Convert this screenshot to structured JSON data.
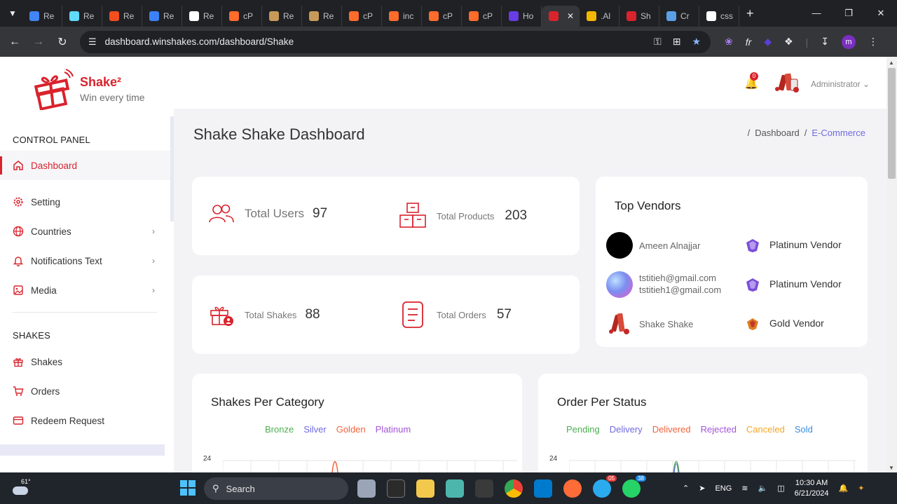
{
  "browser": {
    "tabs": [
      {
        "label": "Re",
        "color": "#4285f4"
      },
      {
        "label": "Re",
        "color": "#61dafb"
      },
      {
        "label": "Re",
        "color": "#f24e1e"
      },
      {
        "label": "Re",
        "color": "#3b82f6"
      },
      {
        "label": "Re",
        "color": "#ffffff"
      },
      {
        "label": "cP",
        "color": "#ff6c2c"
      },
      {
        "label": "Re",
        "color": "#c79a5a"
      },
      {
        "label": "Re",
        "color": "#c79a5a"
      },
      {
        "label": "cP",
        "color": "#ff6c2c"
      },
      {
        "label": "inc",
        "color": "#ff6c2c"
      },
      {
        "label": "cP",
        "color": "#ff6c2c"
      },
      {
        "label": "cP",
        "color": "#ff6c2c"
      },
      {
        "label": "Ho",
        "color": "#673de6"
      },
      {
        "label": "",
        "color": "#d9232d",
        "active": true
      },
      {
        "label": ".Al",
        "color": "#f5b800"
      },
      {
        "label": "Sh",
        "color": "#d9232d"
      },
      {
        "label": "Cr",
        "color": "#5aa0e6"
      },
      {
        "label": "css",
        "color": "#ffffff"
      }
    ],
    "url": "dashboard.winshakes.com/dashboard/Shake",
    "profile_initial": "m"
  },
  "sidebar": {
    "brand": "Shake²",
    "tagline": "Win every time",
    "control_panel_title": "CONTROL PANEL",
    "control_items": [
      {
        "label": "Dashboard",
        "icon": "home-icon",
        "has_chevron": false
      },
      {
        "label": "Setting",
        "icon": "gear-icon",
        "has_chevron": false
      },
      {
        "label": "Countries",
        "icon": "globe-icon",
        "has_chevron": true
      },
      {
        "label": "Notifications Text",
        "icon": "bell-icon",
        "has_chevron": true
      },
      {
        "label": "Media",
        "icon": "image-icon",
        "has_chevron": true
      }
    ],
    "shakes_title": "SHAKES",
    "shakes_items": [
      {
        "label": "Shakes",
        "icon": "gift-icon"
      },
      {
        "label": "Orders",
        "icon": "cart-icon"
      },
      {
        "label": "Redeem Request",
        "icon": "card-icon"
      }
    ]
  },
  "header": {
    "notification_count": "0",
    "user_name": "Administrator"
  },
  "page": {
    "title": "Shake Shake Dashboard",
    "breadcrumb": {
      "sep": "/",
      "parent": "Dashboard",
      "current": "E-Commerce"
    }
  },
  "stats": {
    "total_users": {
      "label": "Total Users",
      "value": "97"
    },
    "total_products": {
      "label": "Total Products",
      "value": "203"
    },
    "total_shakes": {
      "label": "Total Shakes",
      "value": "88"
    },
    "total_orders": {
      "label": "Total Orders",
      "value": "57"
    }
  },
  "top_vendors": {
    "title": "Top Vendors",
    "rows": [
      {
        "name_line1": "Ameen Alnajjar",
        "name_line2": "",
        "level": "Platinum Vendor",
        "avatar": "black"
      },
      {
        "name_line1": "tstitieh@gmail.com",
        "name_line2": "tstitieh1@gmail.com",
        "level": "Platinum Vendor",
        "avatar": "gradient"
      },
      {
        "name_line1": "Shake Shake",
        "name_line2": "",
        "level": "Gold Vendor",
        "avatar": "product"
      }
    ]
  },
  "charts": {
    "shakes_per_category": {
      "title": "Shakes Per Category",
      "legend": [
        {
          "label": "Bronze",
          "color": "#4caf50"
        },
        {
          "label": "Silver",
          "color": "#6f6ae0"
        },
        {
          "label": "Golden",
          "color": "#f0643c"
        },
        {
          "label": "Platinum",
          "color": "#a155d9"
        }
      ],
      "y_tick": "24"
    },
    "order_per_status": {
      "title": "Order Per Status",
      "legend": [
        {
          "label": "Pending",
          "color": "#4caf50"
        },
        {
          "label": "Delivery",
          "color": "#6f6ae0"
        },
        {
          "label": "Delivered",
          "color": "#f0643c"
        },
        {
          "label": "Rejected",
          "color": "#a155d9"
        },
        {
          "label": "Canceled",
          "color": "#f5a623"
        },
        {
          "label": "Sold",
          "color": "#3d8fe0"
        }
      ],
      "y_tick": "24"
    }
  },
  "taskbar": {
    "temperature": "61°",
    "search_label": "Search",
    "badge_1": "38",
    "badge_2": "05",
    "language": "ENG",
    "time": "10:30 AM",
    "date": "6/21/2024"
  }
}
